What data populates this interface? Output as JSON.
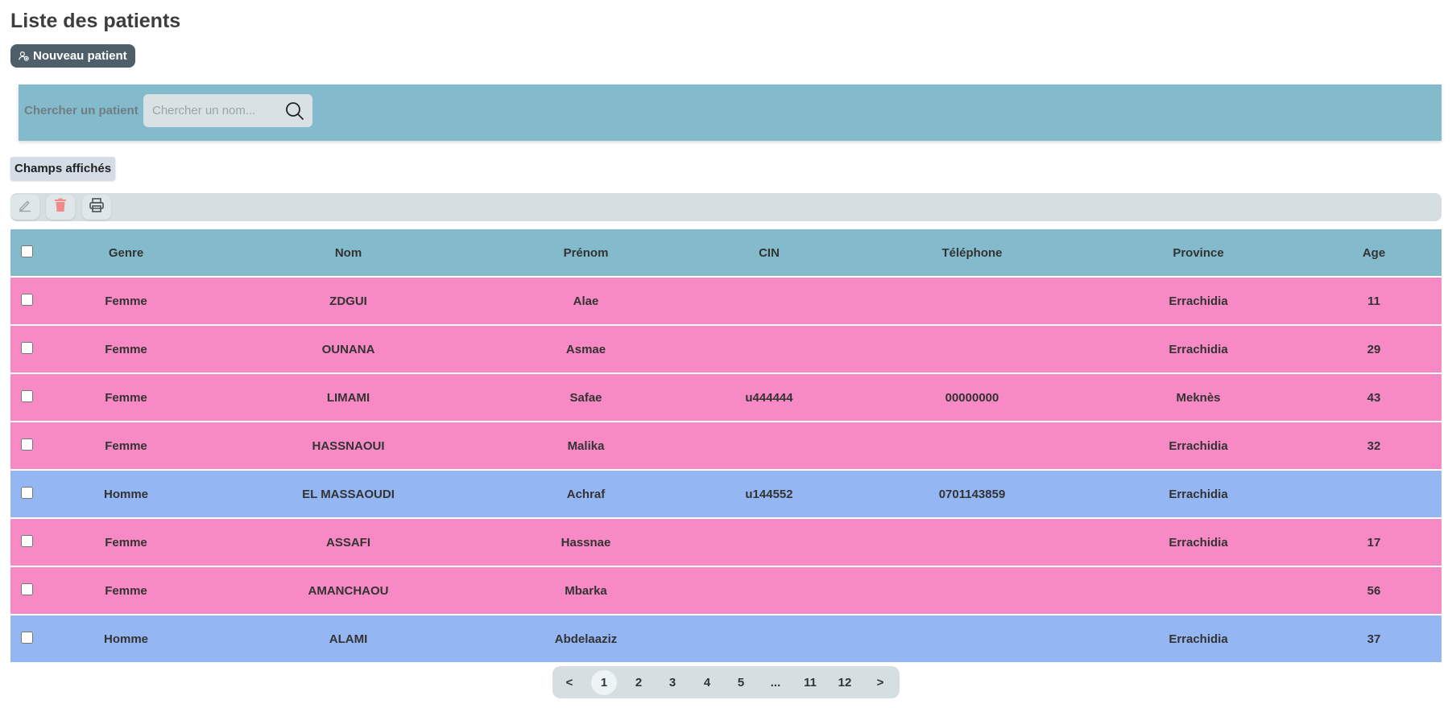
{
  "page": {
    "title": "Liste des patients",
    "new_patient_label": "Nouveau patient"
  },
  "search": {
    "label": "Chercher un patient",
    "placeholder": "Chercher un nom...",
    "value": ""
  },
  "fields_button_label": "Champs affichés",
  "toolbar": {
    "edit_icon": "pencil-icon",
    "delete_icon": "trash-icon",
    "print_icon": "printer-icon"
  },
  "table": {
    "columns": [
      "Genre",
      "Nom",
      "Prénom",
      "CIN",
      "Téléphone",
      "Province",
      "Age"
    ],
    "rows": [
      {
        "genre": "Femme",
        "nom": "ZDGUI",
        "prenom": "Alae",
        "cin": "",
        "telephone": "",
        "province": "Errachidia",
        "age": "11"
      },
      {
        "genre": "Femme",
        "nom": "OUNANA",
        "prenom": "Asmae",
        "cin": "",
        "telephone": "",
        "province": "Errachidia",
        "age": "29"
      },
      {
        "genre": "Femme",
        "nom": "LIMAMI",
        "prenom": "Safae",
        "cin": "u444444",
        "telephone": "00000000",
        "province": "Meknès",
        "age": "43"
      },
      {
        "genre": "Femme",
        "nom": "HASSNAOUI",
        "prenom": "Malika",
        "cin": "",
        "telephone": "",
        "province": "Errachidia",
        "age": "32"
      },
      {
        "genre": "Homme",
        "nom": "EL MASSAOUDI",
        "prenom": "Achraf",
        "cin": "u144552",
        "telephone": "0701143859",
        "province": "Errachidia",
        "age": ""
      },
      {
        "genre": "Femme",
        "nom": "ASSAFI",
        "prenom": "Hassnae",
        "cin": "",
        "telephone": "",
        "province": "Errachidia",
        "age": "17"
      },
      {
        "genre": "Femme",
        "nom": "AMANCHAOU",
        "prenom": "Mbarka",
        "cin": "",
        "telephone": "",
        "province": "",
        "age": "56"
      },
      {
        "genre": "Homme",
        "nom": "ALAMI",
        "prenom": "Abdelaaziz",
        "cin": "",
        "telephone": "",
        "province": "Errachidia",
        "age": "37"
      }
    ]
  },
  "pagination": {
    "prev": "<",
    "next": ">",
    "pages": [
      "1",
      "2",
      "3",
      "4",
      "5",
      "...",
      "11",
      "12"
    ],
    "current": "1"
  },
  "colors": {
    "femme_row": "#f78ac5",
    "homme_row": "#94b6f3",
    "header": "#83bacc",
    "primary_button": "#4f5f69"
  }
}
